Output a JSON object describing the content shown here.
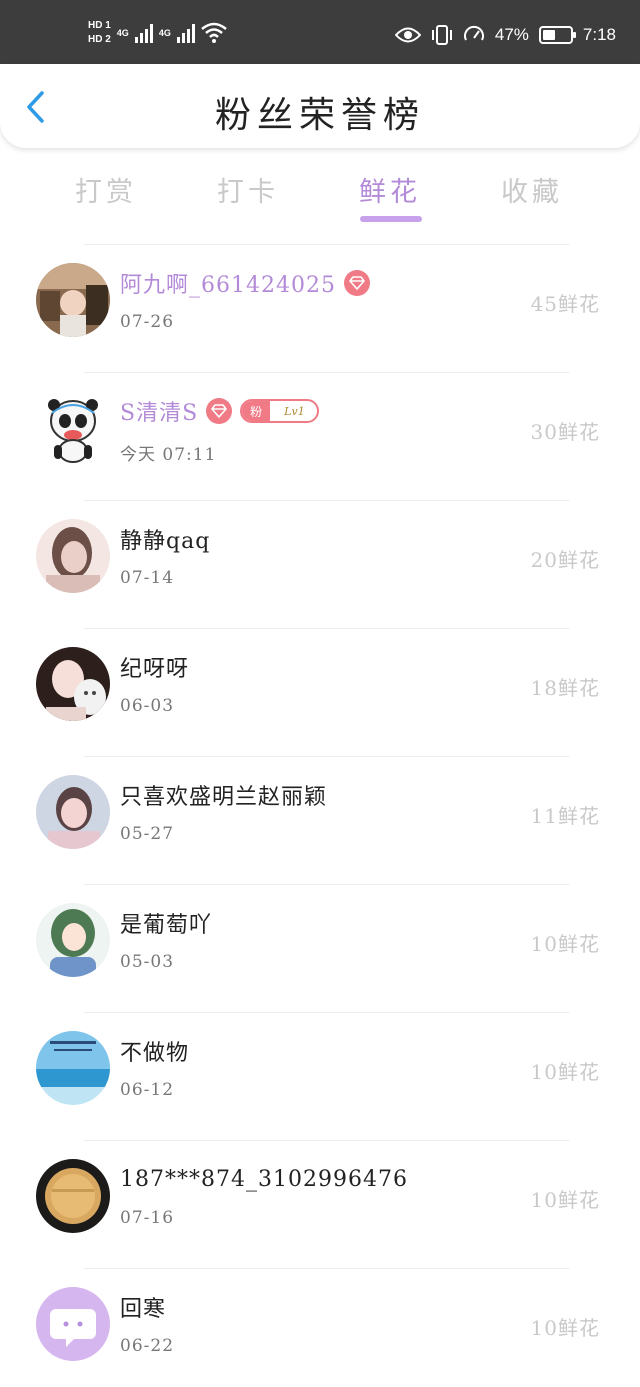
{
  "status_bar": {
    "hd1": "HD 1",
    "hd2": "HD 2",
    "net1": "4G",
    "net2": "4G",
    "battery_percent": "47%",
    "battery_level": 0.47,
    "time": "7:18"
  },
  "header": {
    "title": "粉丝荣誉榜"
  },
  "tabs": [
    {
      "label": "打赏",
      "active": false
    },
    {
      "label": "打卡",
      "active": false
    },
    {
      "label": "鲜花",
      "active": true
    },
    {
      "label": "收藏",
      "active": false
    }
  ],
  "fans": [
    {
      "name": "阿九啊_661424025",
      "date": "07-26",
      "count": "45鲜花",
      "vip": true,
      "gem": true,
      "fan_badge": false
    },
    {
      "name": "S清清S",
      "date": "今天 07:11",
      "count": "30鲜花",
      "vip": true,
      "gem": true,
      "fan_badge": true,
      "fan_badge_label": "粉",
      "fan_badge_level": "Lv1"
    },
    {
      "name": "静静qaq",
      "date": "07-14",
      "count": "20鲜花",
      "vip": false,
      "gem": false,
      "fan_badge": false
    },
    {
      "name": "纪呀呀",
      "date": "06-03",
      "count": "18鲜花",
      "vip": false,
      "gem": false,
      "fan_badge": false
    },
    {
      "name": "只喜欢盛明兰赵丽颖",
      "date": "05-27",
      "count": "11鲜花",
      "vip": false,
      "gem": false,
      "fan_badge": false
    },
    {
      "name": "是葡萄吖",
      "date": "05-03",
      "count": "10鲜花",
      "vip": false,
      "gem": false,
      "fan_badge": false
    },
    {
      "name": "不做物",
      "date": "06-12",
      "count": "10鲜花",
      "vip": false,
      "gem": false,
      "fan_badge": false
    },
    {
      "name": "187***874_3102996476",
      "date": "07-16",
      "count": "10鲜花",
      "vip": false,
      "gem": false,
      "fan_badge": false
    },
    {
      "name": "回寒",
      "date": "06-22",
      "count": "10鲜花",
      "vip": false,
      "gem": false,
      "fan_badge": false
    }
  ],
  "colors": {
    "accent": "#b38ad8",
    "underline": "#c7a2ea",
    "badge": "#f07b86",
    "back_arrow": "#2f9ae5",
    "status_bar": "#3d3d3d"
  }
}
